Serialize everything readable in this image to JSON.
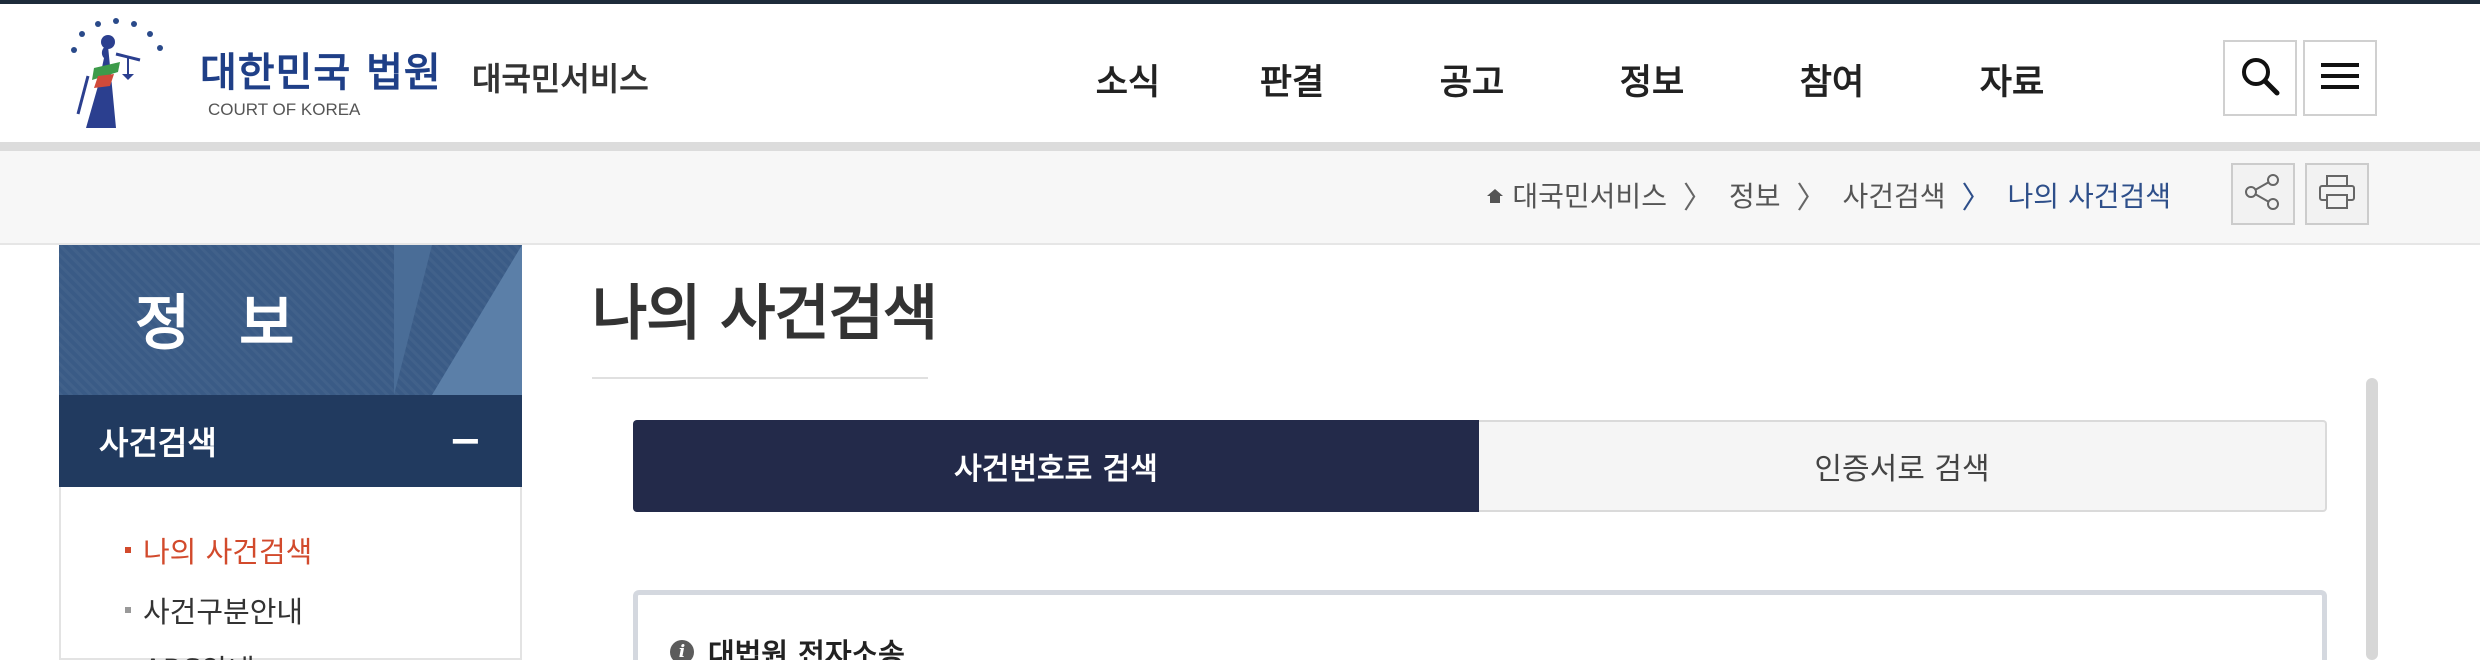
{
  "header": {
    "brand_title": "대한민국 법원",
    "brand_sub": "COURT OF KOREA",
    "brand_service": "대국민서비스",
    "nav": [
      "소식",
      "판결",
      "공고",
      "정보",
      "참여",
      "자료"
    ],
    "icons": {
      "search": "search-icon",
      "menu": "hamburger-menu-icon"
    }
  },
  "breadcrumb": {
    "items": [
      "대국민서비스",
      "정보",
      "사건검색",
      "나의 사건검색"
    ],
    "separator": "〉",
    "icons": {
      "home": "home-icon",
      "share": "share-icon",
      "print": "print-icon"
    }
  },
  "sidebar": {
    "title": "정 보",
    "section": "사건검색",
    "section_toggle": "−",
    "items": [
      "나의 사건검색",
      "사건구분안내",
      "ARS안내"
    ]
  },
  "main": {
    "title": "나의 사건검색",
    "tabs": [
      "사건번호로 검색",
      "인증서로 검색"
    ],
    "notice_heading": "대법원 전자소송",
    "notice_icon": "info-icon"
  },
  "colors": {
    "brand_blue": "#1f3f87",
    "sidebar_head": "#3a5b86",
    "sidebar_section": "#213a5f",
    "active_tab": "#232a4a",
    "active_side_item": "#d24a2c",
    "breadcrumb_current": "#2e4f8a"
  }
}
